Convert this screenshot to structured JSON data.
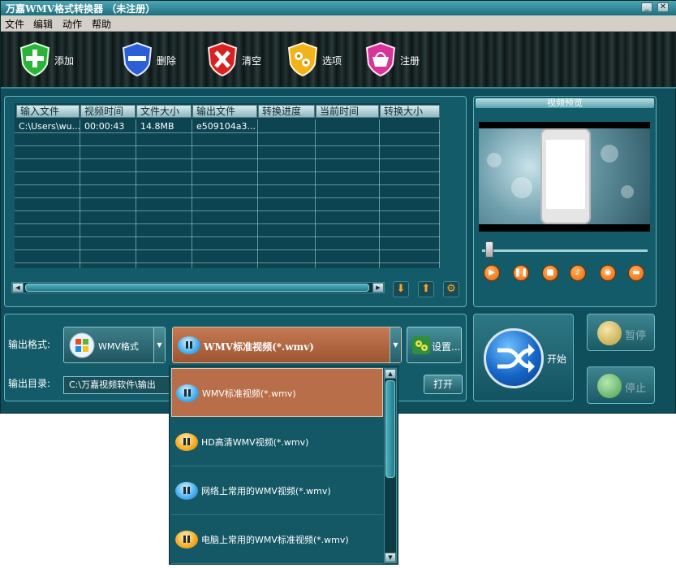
{
  "window": {
    "title": "万嘉WMV格式转换器 （未注册）"
  },
  "menu": [
    "文件",
    "编辑",
    "动作",
    "帮助"
  ],
  "toolbar": {
    "add": "添加",
    "delete": "删除",
    "clear": "清空",
    "options": "选项",
    "register": "注册"
  },
  "filelist": {
    "headers": [
      "输入文件",
      "视频时间",
      "文件大小",
      "输出文件",
      "转换进度",
      "当前时间",
      "转换大小"
    ],
    "rows": [
      [
        "C:\\Users\\wu...",
        "00:00:43",
        "14.8MB",
        "e509104a3...",
        "",
        "",
        ""
      ]
    ]
  },
  "preview": {
    "title": "视频预览",
    "seek_fraction": 0.02
  },
  "output": {
    "format_label": "输出格式:",
    "format_value": "WMV格式",
    "profile_value": "WMV标准视频(*.wmv)",
    "settings_button": "设置...",
    "dir_label": "输出目录:",
    "dir_value": "C:\\万嘉视频软件\\输出",
    "open_button": "打开"
  },
  "actions": {
    "start": "开始",
    "pause": "暂停",
    "stop": "停止"
  },
  "dropdown": {
    "options": [
      {
        "label": "WMV标准视频(*.wmv)",
        "color": "blue",
        "selected": true
      },
      {
        "label": "HD高清WMV视频(*.wmv)",
        "color": "orange",
        "selected": false
      },
      {
        "label": "网络上常用的WMV视频(*.wmv)",
        "color": "blue",
        "selected": false
      },
      {
        "label": "电脑上常用的WMV标准视频(*.wmv)",
        "color": "orange",
        "selected": false
      }
    ]
  },
  "colors": {
    "panel_bg": "#135b68",
    "accent_orange": "#e8650b",
    "selected_option": "#b86f49"
  }
}
